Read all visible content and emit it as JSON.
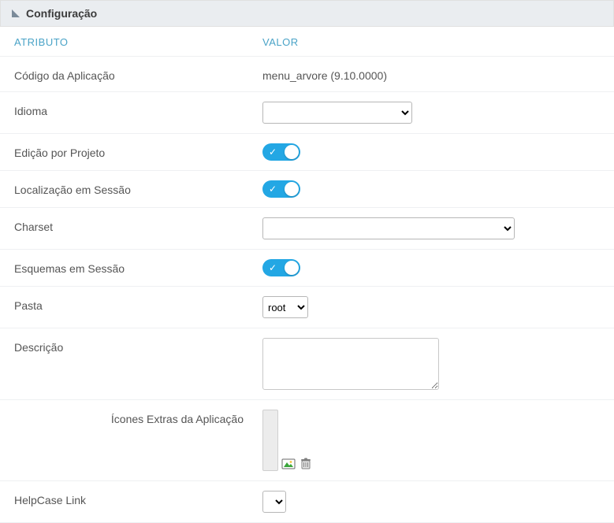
{
  "header": {
    "title": "Configuração"
  },
  "columns": {
    "attr": "ATRIBUTO",
    "val": "VALOR"
  },
  "rows": {
    "codigo": {
      "label": "Código da Aplicação",
      "value": "menu_arvore (9.10.0000)"
    },
    "idioma": {
      "label": "Idioma"
    },
    "edicao_projeto": {
      "label": "Edição por Projeto"
    },
    "localizacao_sessao": {
      "label": "Localização em Sessão"
    },
    "charset": {
      "label": "Charset"
    },
    "esquemas_sessao": {
      "label": "Esquemas em Sessão"
    },
    "pasta": {
      "label": "Pasta",
      "selected": "root"
    },
    "descricao": {
      "label": "Descrição"
    },
    "icones_extras": {
      "label": "Ícones Extras da Aplicação"
    },
    "helpcase": {
      "label": "HelpCase Link"
    }
  }
}
